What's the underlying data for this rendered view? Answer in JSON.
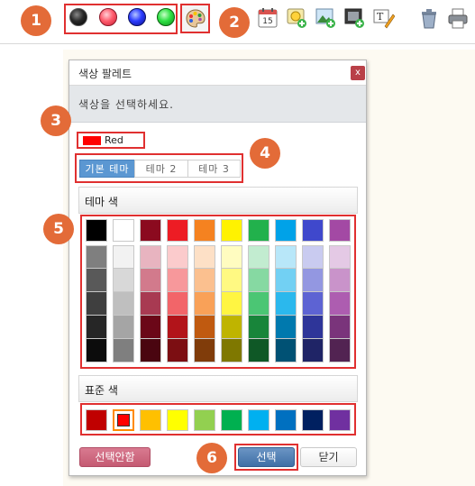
{
  "badges": [
    "1",
    "2",
    "3",
    "4",
    "5",
    "6"
  ],
  "toolbar": {
    "color_buttons": [
      {
        "name": "black-color-button",
        "color": "#000000"
      },
      {
        "name": "red-color-button",
        "color": "#ff4b5c"
      },
      {
        "name": "blue-color-button",
        "color": "#2c3cff"
      },
      {
        "name": "green-color-button",
        "color": "#2ee043"
      }
    ],
    "palette_icon": "palette-icon",
    "tools": [
      "calendar-icon",
      "add-emoticon-icon",
      "add-image-icon",
      "add-video-icon",
      "text-edit-icon",
      "trash-icon",
      "print-icon"
    ],
    "calendar_day": "15"
  },
  "dialog": {
    "title": "색상 팔레트",
    "close_label": "x",
    "instruction": "색상을 선택하세요.",
    "selected_color": {
      "label": "Red",
      "color": "#ff0000"
    },
    "tabs": [
      {
        "label": "기본 테마",
        "active": true
      },
      {
        "label": "테마 2",
        "active": false
      },
      {
        "label": "테마 3",
        "active": false
      }
    ],
    "theme_header": "테마 색",
    "theme_top_row": [
      "#000000",
      "#ffffff",
      "#8b0a1f",
      "#ed1c24",
      "#f58220",
      "#fff200",
      "#22b14c",
      "#00a2e8",
      "#3f48cc",
      "#a349a4"
    ],
    "theme_shades": [
      [
        "#7f7f7f",
        "#595959",
        "#3f3f3f",
        "#262626",
        "#0c0c0c"
      ],
      [
        "#f2f2f2",
        "#d8d8d8",
        "#bfbfbf",
        "#a5a5a5",
        "#7f7f7f"
      ],
      [
        "#e8b4c0",
        "#d27a8c",
        "#a83a52",
        "#6b0718",
        "#4a0510"
      ],
      [
        "#fbcbcc",
        "#f7989b",
        "#f26569",
        "#b2141a",
        "#7c0e12"
      ],
      [
        "#fde0c6",
        "#fbc08f",
        "#f9a158",
        "#c05a10",
        "#803c0a"
      ],
      [
        "#fffcc0",
        "#fff982",
        "#fff542",
        "#bfb400",
        "#7f7800"
      ],
      [
        "#c2ecd0",
        "#86d9a2",
        "#4bc674",
        "#18853a",
        "#0f5826"
      ],
      [
        "#b8e7f9",
        "#72d0f3",
        "#2bb8ed",
        "#0079ae",
        "#005174"
      ],
      [
        "#c9cbf0",
        "#9397e1",
        "#5d63d3",
        "#2e3599",
        "#1f2466"
      ],
      [
        "#e4c9e5",
        "#c993ca",
        "#ad5db0",
        "#7a347b",
        "#522352"
      ]
    ],
    "standard_header": "표준 색",
    "standard_colors": [
      "#c00000",
      "#ff0000",
      "#ffc000",
      "#ffff00",
      "#92d050",
      "#00b050",
      "#00b0f0",
      "#0070c0",
      "#002060",
      "#7030a0"
    ],
    "standard_selected_index": 1,
    "btn_no_select": "선택안함",
    "btn_select": "선택",
    "btn_close": "닫기"
  }
}
